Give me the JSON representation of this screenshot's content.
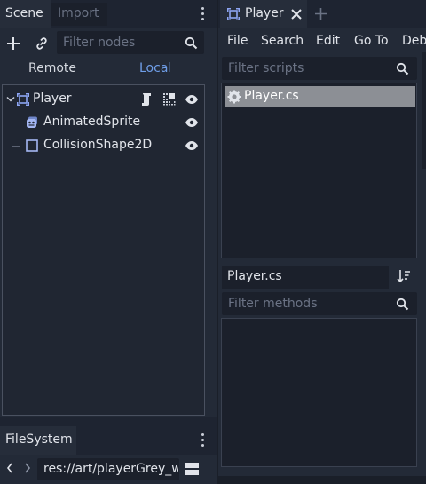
{
  "scene_dock": {
    "tabs": [
      {
        "label": "Scene",
        "active": true
      },
      {
        "label": "Import",
        "active": false
      }
    ],
    "filter_placeholder": "Filter nodes",
    "remote_label": "Remote",
    "local_label": "Local",
    "tree": [
      {
        "label": "Player",
        "icon": "node2d-icon",
        "level": 0,
        "has_script": true,
        "group_icon": true,
        "visible": true
      },
      {
        "label": "AnimatedSprite",
        "icon": "animated-sprite-icon",
        "level": 1,
        "visible": true
      },
      {
        "label": "CollisionShape2D",
        "icon": "collision-shape-icon",
        "level": 1,
        "visible": true
      }
    ]
  },
  "filesystem_dock": {
    "tab_label": "FileSystem",
    "path_value": "res://art/playerGrey_w"
  },
  "editor": {
    "scene_tab_label": "Player",
    "menu": [
      "File",
      "Search",
      "Edit",
      "Go To",
      "Debu"
    ],
    "filter_scripts_placeholder": "Filter scripts",
    "scripts": [
      {
        "label": "Player.cs",
        "selected": true
      }
    ],
    "current_script_label": "Player.cs",
    "filter_methods_placeholder": "Filter methods"
  },
  "colors": {
    "accent": "#6f9ee8",
    "background": "#1e2431",
    "panel": "#232a37",
    "selection": "#8c8f95"
  }
}
